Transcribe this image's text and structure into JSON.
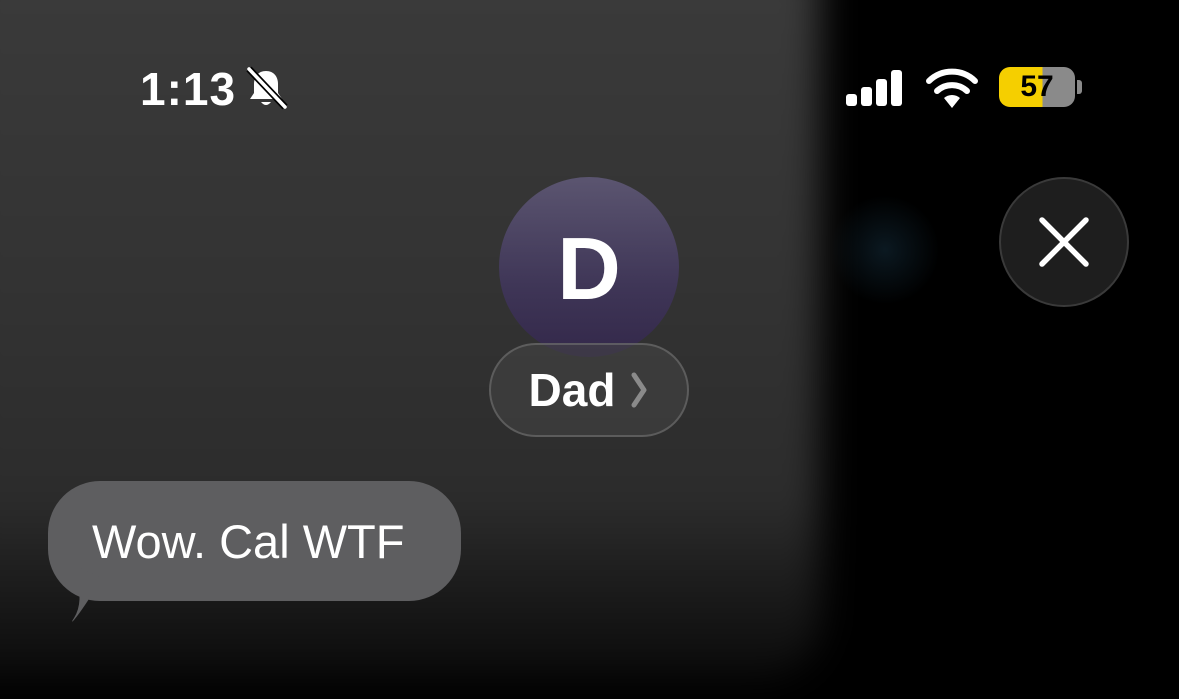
{
  "status_bar": {
    "time": "1:13",
    "silent_icon": "bell-slash-icon",
    "signal_icon": "cellular-signal-icon",
    "wifi_icon": "wifi-icon",
    "battery_level": "57",
    "battery_fill_fraction": 0.57,
    "battery_color": "#f5cf00"
  },
  "contact": {
    "avatar_initial": "D",
    "name": "Dad",
    "chevron_icon": "chevron-right-icon"
  },
  "close_button": {
    "icon": "close-icon"
  },
  "messages": [
    {
      "text": "Wow. Cal WTF",
      "direction": "incoming"
    }
  ],
  "colors": {
    "bubble": "#5e5e60",
    "avatar": "#3f3657"
  }
}
